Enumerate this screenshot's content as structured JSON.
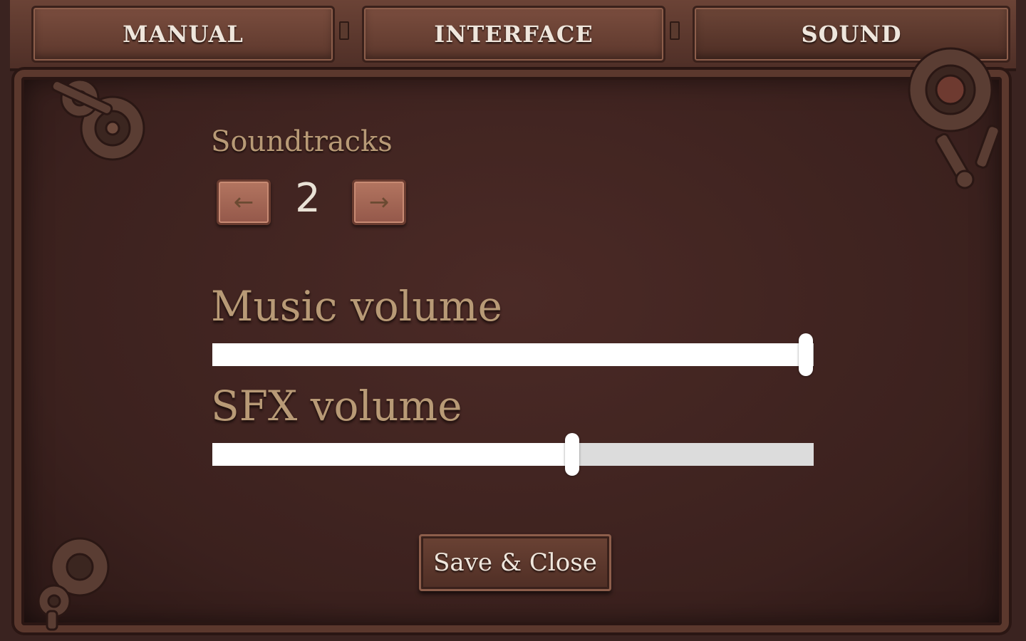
{
  "tabs": {
    "manual": "MANUAL",
    "interface": "INTERFACE",
    "sound": "SOUND"
  },
  "soundtracks": {
    "label": "Soundtracks",
    "current": "2",
    "prev_icon": "←",
    "next_icon": "→"
  },
  "music": {
    "label": "Music volume",
    "value_fraction": 0.987
  },
  "sfx": {
    "label": "SFX volume",
    "value_fraction": 0.598
  },
  "save_button": "Save & Close",
  "colors": {
    "panel": "#3b211e",
    "frame": "#5b382d",
    "label_gold": "#b89a76",
    "slider_fill": "#ffffff",
    "slider_track": "#dcdcdc"
  },
  "icons": [
    "gear-icon",
    "arrow-left-icon",
    "arrow-right-icon"
  ]
}
